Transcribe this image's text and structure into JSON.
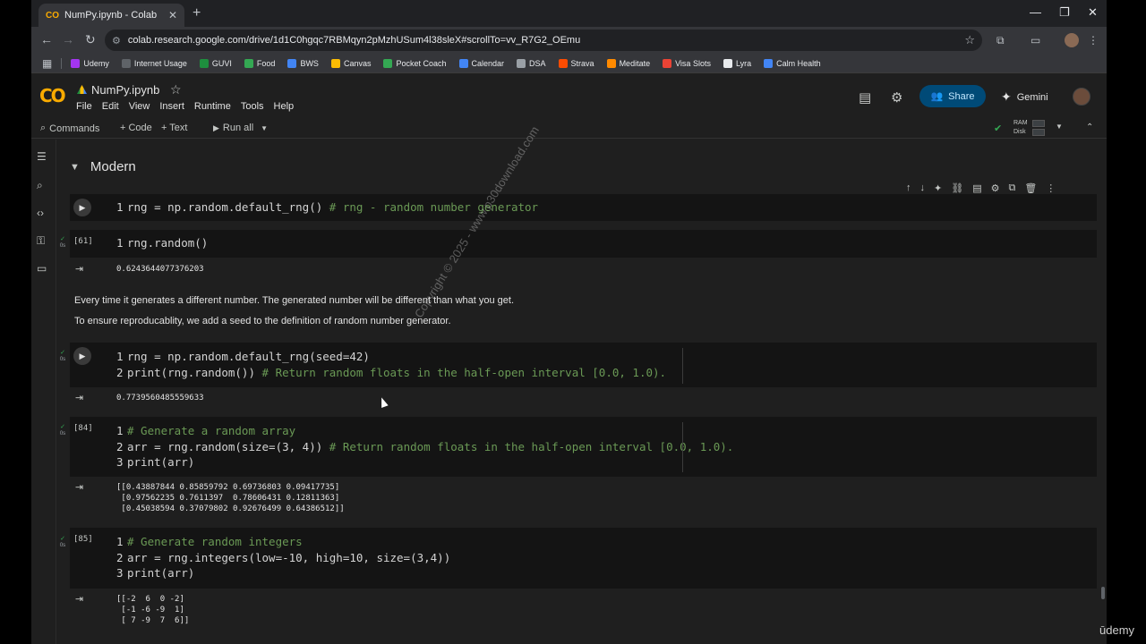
{
  "browser": {
    "tab_title": "NumPy.ipynb - Colab",
    "tab_favicon": "CO",
    "url": "colab.research.google.com/drive/1d1C0hgqc7RBMqyn2pMzhUSum4l38sleX#scrollTo=vv_R7G2_OEmu",
    "bookmarks": [
      {
        "label": "Udemy",
        "color": "#a435f0"
      },
      {
        "label": "Internet Usage",
        "color": "#5f6368"
      },
      {
        "label": "GUVI",
        "color": "#1e8e3e"
      },
      {
        "label": "Food",
        "color": "#34a853"
      },
      {
        "label": "BWS",
        "color": "#4285f4"
      },
      {
        "label": "Canvas",
        "color": "#fbbc04"
      },
      {
        "label": "Pocket Coach",
        "color": "#34a853"
      },
      {
        "label": "Calendar",
        "color": "#4285f4"
      },
      {
        "label": "DSA",
        "color": "#9aa0a6"
      },
      {
        "label": "Strava",
        "color": "#fc4c02"
      },
      {
        "label": "Meditate",
        "color": "#ff8a00"
      },
      {
        "label": "Visa Slots",
        "color": "#ea4335"
      },
      {
        "label": "Lyra",
        "color": "#e8eaed"
      },
      {
        "label": "Calm Health",
        "color": "#4285f4"
      }
    ]
  },
  "colab": {
    "logo": "CO",
    "notebook_name": "NumPy.ipynb",
    "menu": [
      "File",
      "Edit",
      "View",
      "Insert",
      "Runtime",
      "Tools",
      "Help"
    ],
    "share_label": "Share",
    "gemini_label": "Gemini",
    "toolbar": {
      "commands": "Commands",
      "code": "+ Code",
      "text": "+ Text",
      "run_all": "Run all",
      "ram": "RAM",
      "disk": "Disk"
    }
  },
  "notebook": {
    "section_title": "Modern",
    "cells": [
      {
        "exec": "",
        "lines": [
          {
            "n": "1",
            "code": "rng = np.random.default_rng() ",
            "comment": "# rng - random number generator"
          }
        ]
      },
      {
        "exec": "[61]",
        "lines": [
          {
            "n": "1",
            "code": "rng.random()",
            "comment": ""
          }
        ],
        "output": "0.6243644077376203"
      },
      {
        "exec": "",
        "lines": [
          {
            "n": "1",
            "code": "rng = np.random.default_rng(seed=42)",
            "comment": ""
          },
          {
            "n": "2",
            "code": "print(rng.random()) ",
            "comment": "# Return random floats in the half-open interval [0.0, 1.0)."
          }
        ],
        "output": "0.7739560485559633"
      },
      {
        "exec": "[84]",
        "lines": [
          {
            "n": "1",
            "code": "",
            "comment": "# Generate a random array"
          },
          {
            "n": "2",
            "code": "arr = rng.random(size=(3, 4)) ",
            "comment": "# Return random floats in the half-open interval [0.0, 1.0)."
          },
          {
            "n": "3",
            "code": "print(arr)",
            "comment": ""
          }
        ],
        "output": "[[0.43887844 0.85859792 0.69736803 0.09417735]\n [0.97562235 0.7611397  0.78606431 0.12811363]\n [0.45038594 0.37079802 0.92676499 0.64386512]]"
      },
      {
        "exec": "[85]",
        "lines": [
          {
            "n": "1",
            "code": "",
            "comment": "# Generate random integers"
          },
          {
            "n": "2",
            "code": "arr = rng.integers(low=-10, high=10, size=(3,4))",
            "comment": ""
          },
          {
            "n": "3",
            "code": "print(arr)",
            "comment": ""
          }
        ],
        "output": "[[-2  6  0 -2]\n [-1 -6 -9  1]\n [ 7 -9  7  6]]"
      }
    ],
    "text_cell": {
      "line1": "Every time it generates a different number. The generated number will be different than what you get.",
      "line2": "To ensure reproducablity, we add a seed to the definition of random number generator."
    },
    "cell_status": "0s"
  },
  "overlay": {
    "watermark": "Copyright © 2025 - www.p30download.com",
    "udemy": "ūdemy"
  }
}
